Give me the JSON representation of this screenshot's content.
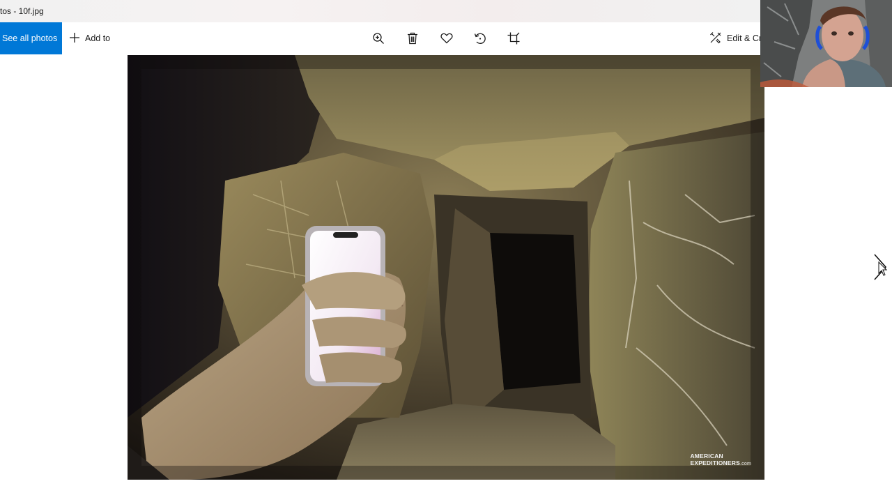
{
  "window": {
    "title": "tos - 10f.jpg"
  },
  "toolbar": {
    "see_all_label": "See all photos",
    "add_to_label": "Add to",
    "edit_create_label": "Edit & Cr",
    "icons": [
      "zoom-icon",
      "delete-icon",
      "favorite-icon",
      "rotate-icon",
      "crop-icon",
      "edit-create-icon"
    ]
  },
  "photo": {
    "watermark_line1": "AMERICAN",
    "watermark_line2": "EXPEDITIONERS",
    "watermark_suffix": ".com"
  },
  "colors": {
    "accent": "#0078d7"
  }
}
